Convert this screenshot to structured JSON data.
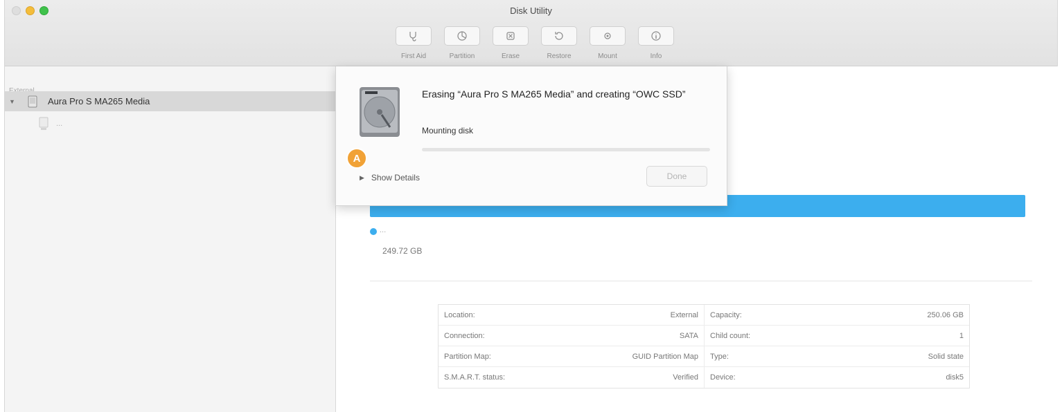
{
  "window": {
    "title": "Disk Utility"
  },
  "toolbar": {
    "items": [
      {
        "label": "First Aid",
        "icon": "stethoscope-icon"
      },
      {
        "label": "Partition",
        "icon": "partition-icon"
      },
      {
        "label": "Erase",
        "icon": "erase-icon"
      },
      {
        "label": "Restore",
        "icon": "restore-icon"
      },
      {
        "label": "Mount",
        "icon": "mount-icon"
      },
      {
        "label": "Info",
        "icon": "info-icon"
      }
    ]
  },
  "sidebar": {
    "section": "External",
    "disk": {
      "name": "Aura Pro S MA265 Media",
      "icon": "external-disk-icon"
    },
    "volume": {
      "name": "...",
      "icon": "volume-icon"
    }
  },
  "sheet": {
    "message": "Erasing “Aura Pro S MA265 Media” and creating “OWC SSD”",
    "status": "Mounting disk",
    "progress": 0.0,
    "show_details": "Show Details",
    "done": "Done",
    "icon": "hard-drive-icon"
  },
  "marker": {
    "label": "A"
  },
  "main": {
    "legend_name": "...",
    "legend_size": "249.72 GB",
    "bar_color": "#3caeee",
    "info": [
      {
        "left_label": "Location:",
        "left_value": "External",
        "right_label": "Capacity:",
        "right_value": "250.06 GB"
      },
      {
        "left_label": "Connection:",
        "left_value": "SATA",
        "right_label": "Child count:",
        "right_value": "1"
      },
      {
        "left_label": "Partition Map:",
        "left_value": "GUID Partition Map",
        "right_label": "Type:",
        "right_value": "Solid state"
      },
      {
        "left_label": "S.M.A.R.T. status:",
        "left_value": "Verified",
        "right_label": "Device:",
        "right_value": "disk5"
      }
    ]
  }
}
